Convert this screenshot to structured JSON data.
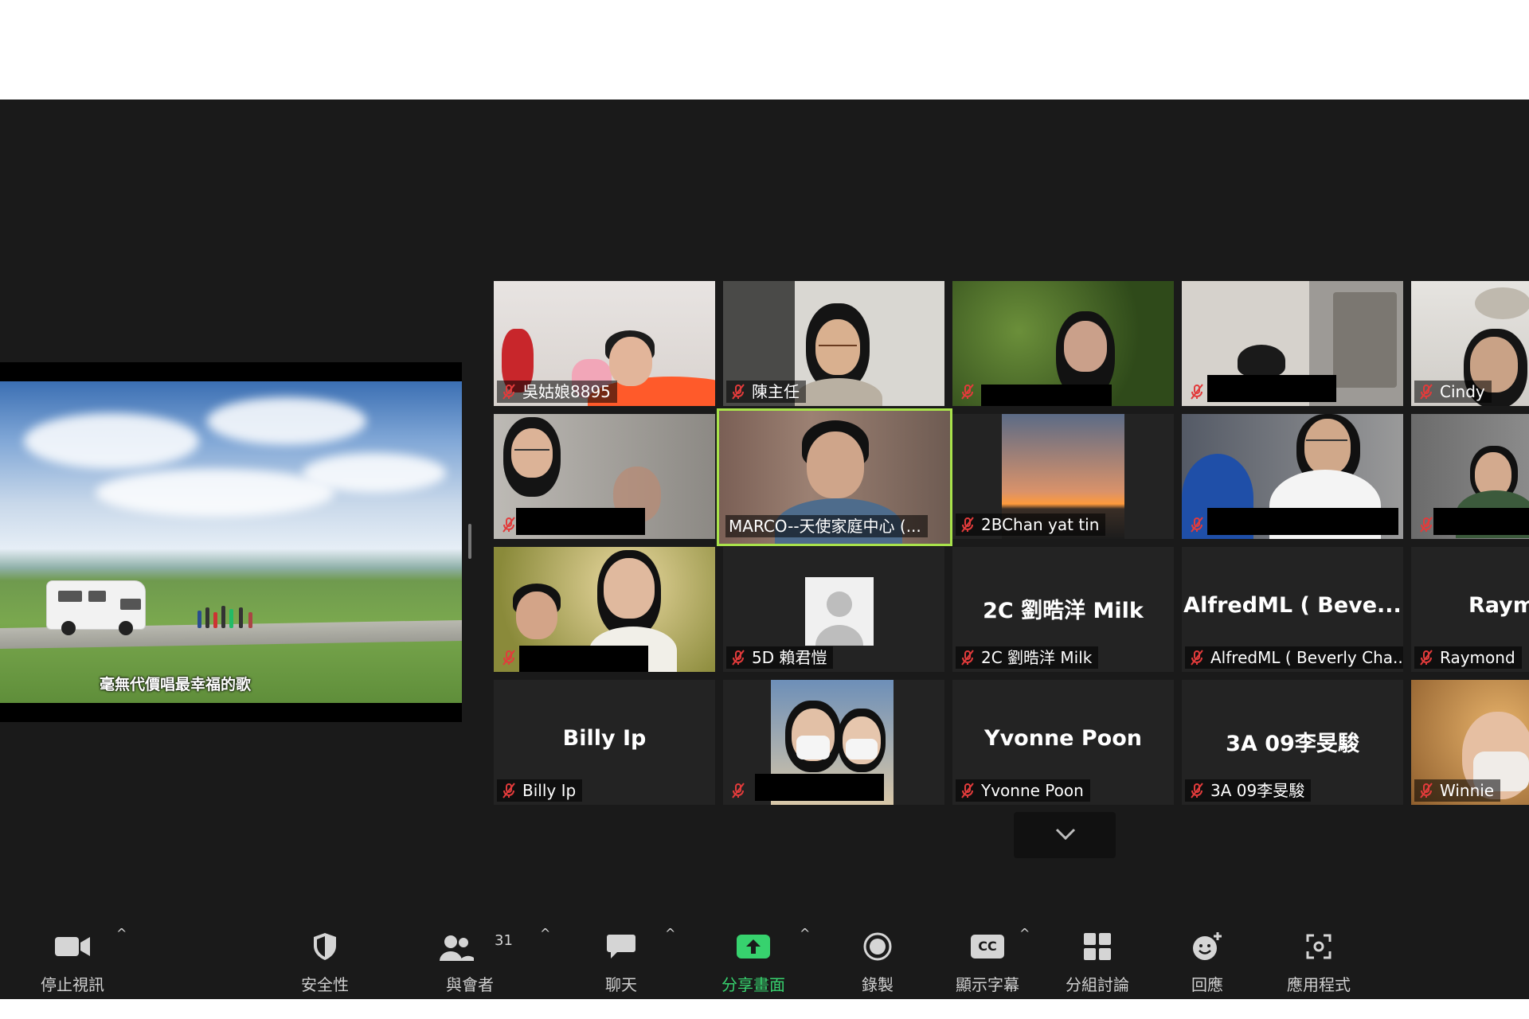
{
  "shared_screen": {
    "subtitle": "毫無代價唱最幸福的歌"
  },
  "participants": [
    {
      "name": "吳姑娘8895",
      "muted": true
    },
    {
      "name": "陳主任",
      "muted": true
    },
    {
      "name": "",
      "muted": true,
      "redacted": true
    },
    {
      "name": "",
      "muted": true,
      "redacted": true
    },
    {
      "name": "Cindy",
      "muted": true
    },
    {
      "name": "",
      "muted": true,
      "redacted": true
    },
    {
      "name": "MARCO--天使家庭中心 (...",
      "muted": false,
      "speaking": true
    },
    {
      "name": "2BChan yat tin",
      "muted": true
    },
    {
      "name": "",
      "muted": true,
      "redacted": true
    },
    {
      "name": "",
      "muted": true,
      "redacted": true
    },
    {
      "name": "",
      "muted": true,
      "redacted": true
    },
    {
      "name": "5D 賴君愷",
      "muted": true
    },
    {
      "name": "2C 劉晧洋 Milk",
      "display": "2C 劉晧洋 Milk",
      "muted": true
    },
    {
      "name": "AlfredML ( Beverly Cha...",
      "display": "AlfredML ( Beve...",
      "muted": true
    },
    {
      "name": "Raymond",
      "display": "Raym",
      "muted": true
    },
    {
      "name": "Billy Ip",
      "display": "Billy Ip",
      "muted": true
    },
    {
      "name": "",
      "muted": true,
      "redacted": true
    },
    {
      "name": "Yvonne Poon",
      "display": "Yvonne Poon",
      "muted": true
    },
    {
      "name": "3A 09李旻駿",
      "display": "3A 09李旻駿",
      "muted": true
    },
    {
      "name": "Winnie",
      "muted": true
    }
  ],
  "toolbar": {
    "stop_video": "停止視訊",
    "security": "安全性",
    "participants": "與會者",
    "participants_count": "31",
    "chat": "聊天",
    "share_screen": "分享畫面",
    "record": "錄製",
    "captions": "顯示字幕",
    "captions_icon_text": "CC",
    "breakout": "分組討論",
    "reactions": "回應",
    "apps": "應用程式",
    "caret": "^"
  },
  "colors": {
    "background": "#1a1a1a",
    "active_speaker": "#a9e34b",
    "share_green": "#37d26e",
    "muted_red": "#e23b3b"
  }
}
